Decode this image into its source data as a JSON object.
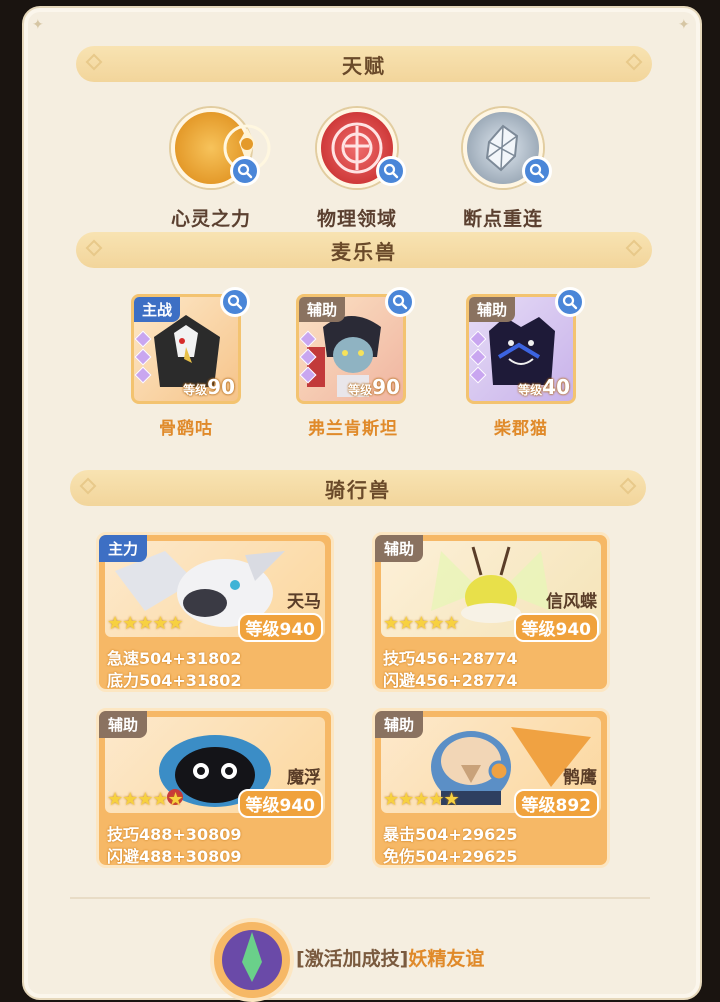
{
  "sections": {
    "talent": "天赋",
    "pets": "麦乐兽",
    "mounts": "骑行兽"
  },
  "talents": [
    {
      "name": "心灵之力",
      "icon": "mind-power-emblem-icon"
    },
    {
      "name": "物理领域",
      "icon": "physical-domain-emblem-icon"
    },
    {
      "name": "断点重连",
      "icon": "reconnect-crystal-emblem-icon"
    }
  ],
  "pets": [
    {
      "role": "主战",
      "level_label": "等级",
      "level": "90",
      "name": "骨鹞咕"
    },
    {
      "role": "辅助",
      "level_label": "等级",
      "level": "90",
      "name": "弗兰肯斯坦"
    },
    {
      "role": "辅助",
      "level_label": "等级",
      "level": "40",
      "name": "柴郡猫"
    }
  ],
  "mounts": [
    {
      "role": "主力",
      "name": "天马",
      "stars": "★★★★★",
      "level": "等级940",
      "stat1": "急速504+31802",
      "stat2": "底力504+31802"
    },
    {
      "role": "辅助",
      "name": "信风蝶",
      "stars": "★★★★★",
      "level": "等级940",
      "stat1": "技巧456+28774",
      "stat2": "闪避456+28774"
    },
    {
      "role": "辅助",
      "name": "魔浮",
      "stars": "★★★★★",
      "level": "等级940",
      "stat1": "技巧488+30809",
      "stat2": "闪避488+30809"
    },
    {
      "role": "辅助",
      "name": "鹘鹰",
      "stars": "★★★★★",
      "level": "等级892",
      "stat1": "暴击504+29625",
      "stat2": "免伤504+29625"
    }
  ],
  "bottom": {
    "bracket_text": "[激活加成技]",
    "skill_name": "妖精友谊"
  },
  "colors": {
    "main_tag": "#3d6fc4",
    "support_tag": "#8a7260",
    "accent_orange": "#e08a2a",
    "panel": "#f5eee0"
  }
}
